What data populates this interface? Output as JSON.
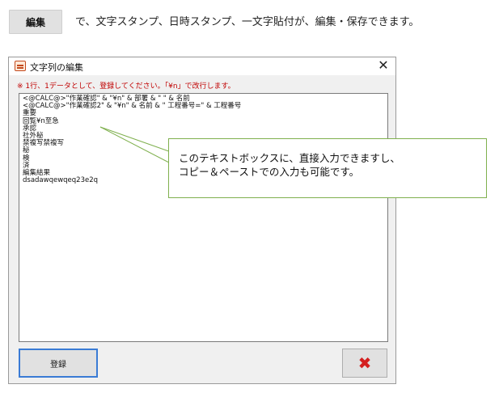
{
  "header": {
    "edit_chip_label": "編集",
    "description": "で、文字スタンプ、日時スタンプ、一文字貼付が、編集・保存できます。"
  },
  "dialog": {
    "title": "文字列の編集",
    "close_glyph": "✕",
    "hint": "※ 1行、1データとして、登録してください。「¥n」で改行します。",
    "lines": [
      "<@CALC@>\"作業確認\" & \"¥n\" & 部署 & \" \" & 名前",
      "<@CALC@>\"作業確認2\" & \"¥n\" & 名前 & \" 工程番号=\" & 工程番号",
      "重要",
      "回覧¥n至急",
      "承認",
      "社外秘",
      "禁複写禁複写",
      "秘",
      "検",
      "済",
      "編集結果",
      "dsadawqewqeq23e2q"
    ],
    "register_label": "登録",
    "cancel_glyph": "✖"
  },
  "callout": {
    "line1": "このテキストボックスに、直接入力できますし、",
    "line2": "コピー＆ペーストでの入力も可能です。"
  },
  "colors": {
    "hint_red": "#c00000",
    "callout_border": "#7fb04e",
    "cancel_red": "#d42020",
    "register_border": "#3a7bd5"
  }
}
